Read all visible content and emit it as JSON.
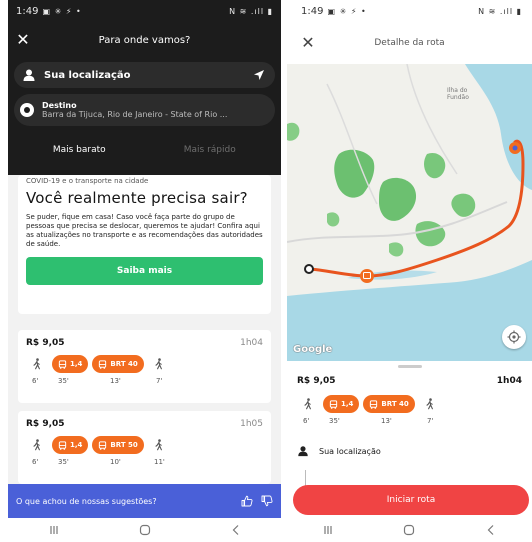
{
  "left": {
    "status": {
      "time": "1:49",
      "icons_left": "▣ ✳ ⚡ •",
      "icons_right": "N ≋ .ıll ▮"
    },
    "topbar": {
      "title": "Para onde vamos?"
    },
    "origin": {
      "value": "Sua localização"
    },
    "destination": {
      "label": "Destino",
      "value": "Barra da Tijuca, Rio de Janeiro - State of Rio ..."
    },
    "tabs": [
      {
        "label": "Mais barato"
      },
      {
        "label": "Mais rápido"
      }
    ],
    "covid": {
      "kicker": "COVID-19 e o transporte na cidade",
      "title": "Você realmente precisa sair?",
      "body": "Se puder, fique em casa! Caso você faça parte do grupo de pessoas que precisa se deslocar, queremos te ajudar! Confira aqui as atualizações no transporte e as recomendações das autoridades de saúde.",
      "button": "Saiba mais"
    },
    "routes": [
      {
        "price": "R$ 9,05",
        "duration": "1h04",
        "bus_line": "1,4",
        "brt_line": "BRT 40",
        "times": [
          "6'",
          "35'",
          "13'",
          "7'"
        ]
      },
      {
        "price": "R$ 9,05",
        "duration": "1h05",
        "bus_line": "1,4",
        "brt_line": "BRT 50",
        "times": [
          "6'",
          "35'",
          "10'",
          "11'"
        ]
      }
    ],
    "feedback": {
      "text": "O que achou de nossas sugestões?"
    }
  },
  "right": {
    "status": {
      "time": "1:49",
      "icons_left": "▣ ✳ ⚡ •",
      "icons_right": "N ≋ .ıll ▮"
    },
    "topbar": {
      "title": "Detalhe da rota"
    },
    "map": {
      "place_label": "Ilha do\nFundão",
      "logo": "Google"
    },
    "route": {
      "price": "R$ 9,05",
      "duration": "1h04",
      "bus_line": "1,4",
      "brt_line": "BRT 40",
      "times": [
        "6'",
        "35'",
        "13'",
        "7'"
      ]
    },
    "origin": {
      "value": "Sua localização"
    },
    "start_button": "Iniciar rota"
  },
  "colors": {
    "dark": "#1c1c1c",
    "orange": "#f26c1f",
    "green": "#2ebf70",
    "blue": "#4a60d8",
    "red": "#f04444"
  }
}
